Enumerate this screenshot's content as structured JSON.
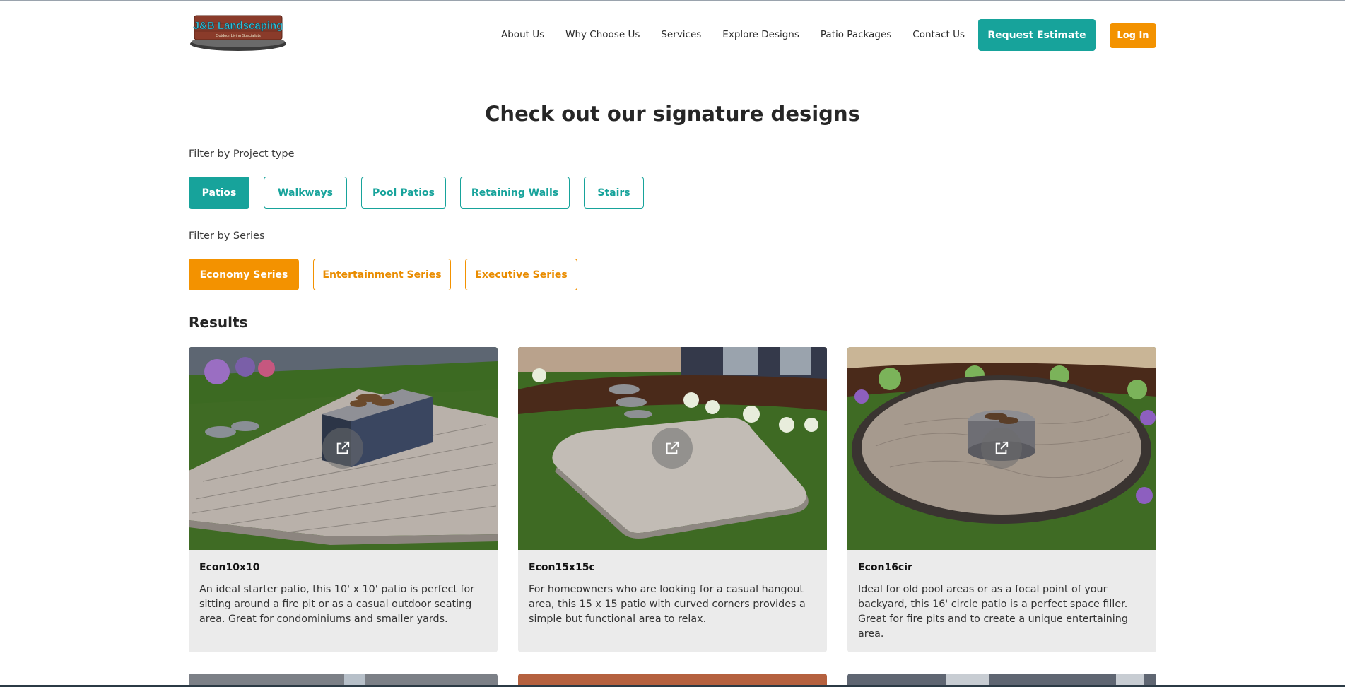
{
  "header": {
    "logo_text": "J&B Landscaping",
    "logo_tagline": "Outdoor Living Specialists",
    "nav": [
      "About Us",
      "Why Choose Us",
      "Services",
      "Explore Designs",
      "Patio Packages",
      "Contact Us"
    ],
    "estimate_label": "Request Estimate",
    "login_label": "Log In"
  },
  "main": {
    "headline": "Check out our signature designs",
    "project_filter_label": "Filter by Project type",
    "project_types": [
      "Patios",
      "Walkways",
      "Pool Patios",
      "Retaining Walls",
      "Stairs"
    ],
    "series_filter_label": "Filter by Series",
    "series": [
      "Economy Series",
      "Entertainment Series",
      "Executive Series"
    ],
    "results_title": "Results"
  },
  "colors": {
    "teal": "#17a39b",
    "orange": "#f39200",
    "card_bg": "#ebebeb"
  },
  "cards": [
    {
      "title": "Econ10x10",
      "description": "An ideal starter patio, this 10' x 10' patio is perfect for sitting around a fire pit or as a casual outdoor seating area. Great for condominiums and smaller yards.",
      "icon": "external-link-icon"
    },
    {
      "title": "Econ15x15c",
      "description": "For homeowners who are looking for a casual hangout area, this 15 x 15 patio with curved corners provides a simple but functional area to relax.",
      "icon": "external-link-icon"
    },
    {
      "title": "Econ16cir",
      "description": "Ideal for old pool areas or as a focal point of your backyard, this 16' circle patio is a perfect space filler. Great for fire pits and to create a unique entertaining area.",
      "icon": "external-link-icon"
    }
  ]
}
